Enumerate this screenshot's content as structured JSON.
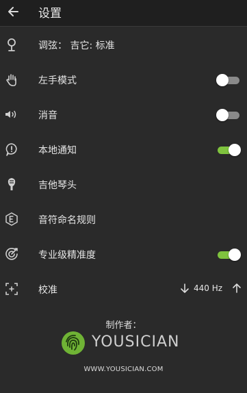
{
  "header": {
    "title": "设置",
    "back_icon": "arrow-left-icon"
  },
  "settings": [
    {
      "label": "调弦： 吉它: 标准",
      "icon": "tuning-fork-icon"
    },
    {
      "label": "左手模式",
      "icon": "left-hand-icon",
      "toggle": false
    },
    {
      "label": "消音",
      "icon": "speaker-icon",
      "toggle": false
    },
    {
      "label": "本地通知",
      "icon": "notification-bubble-icon",
      "toggle": true
    },
    {
      "label": "吉他琴头",
      "icon": "guitar-headstock-icon"
    },
    {
      "label": "音符命名规则",
      "icon": "note-naming-icon"
    },
    {
      "label": "专业级精准度",
      "icon": "precision-target-icon",
      "toggle": true
    },
    {
      "label": "校准",
      "icon": "calibrate-icon",
      "value": "440 Hz"
    }
  ],
  "footer": {
    "made_by": "制作者：",
    "brand": "YOUSICIAN",
    "website": "WWW.YOUSICIAN.COM"
  },
  "colors": {
    "toggle_on": "#7fc33e",
    "toggle_off": "#8a8a8a",
    "background": "#2a2a2a",
    "header": "#1f1f1f"
  }
}
